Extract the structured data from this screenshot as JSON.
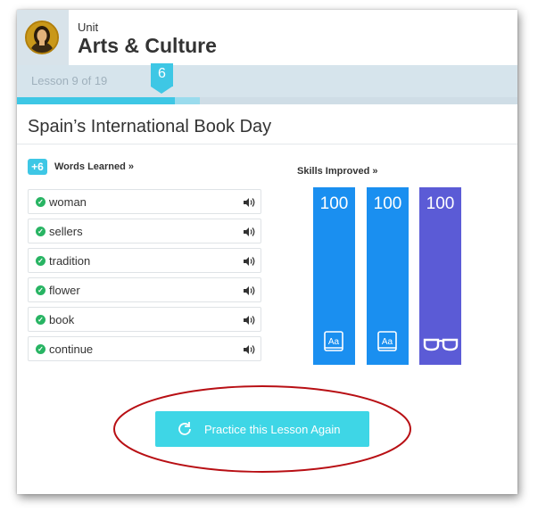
{
  "header": {
    "unit_label": "Unit",
    "unit_title": "Arts & Culture",
    "avatar_icon": "mona-lisa-avatar-icon"
  },
  "progress": {
    "lesson_count": "Lesson 9 of 19",
    "marker_value": "6",
    "completed_fraction": 0.315,
    "current_step_fraction": 0.05
  },
  "lesson": {
    "title": "Spain’s International Book Day"
  },
  "words": {
    "badge": "+6",
    "heading": "Words Learned »",
    "items": [
      {
        "word": "woman"
      },
      {
        "word": "sellers"
      },
      {
        "word": "tradition"
      },
      {
        "word": "flower"
      },
      {
        "word": "book"
      },
      {
        "word": "continue"
      }
    ]
  },
  "skills": {
    "heading": "Skills Improved »",
    "items": [
      {
        "value": "100",
        "icon": "dictionary-book-icon",
        "color": "#1a8ff0"
      },
      {
        "value": "100",
        "icon": "dictionary-book-icon",
        "color": "#1a8ff0"
      },
      {
        "value": "100",
        "icon": "reading-glasses-icon",
        "color": "#5b5bd6"
      }
    ]
  },
  "practice": {
    "label": "Practice this Lesson Again",
    "icon": "refresh-icon"
  },
  "colors": {
    "accent": "#3ec7e5",
    "button": "#3ed6e6",
    "annotation": "#b80f14"
  }
}
